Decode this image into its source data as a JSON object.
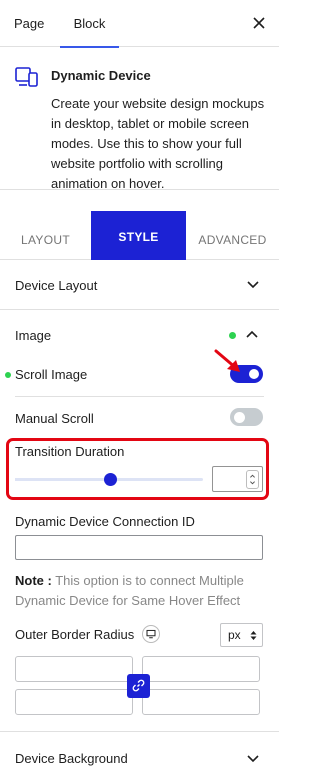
{
  "header": {
    "tabs": [
      {
        "label": "Page"
      },
      {
        "label": "Block"
      }
    ],
    "active_tab": "Block"
  },
  "block": {
    "icon": "device-icon",
    "title": "Dynamic Device",
    "description": "Create your website design mockups in desktop, tablet or mobile screen modes. Use this to show your full website portfolio with scrolling animation on hover."
  },
  "style_tabs": {
    "items": [
      {
        "label": "LAYOUT"
      },
      {
        "label": "STYLE"
      },
      {
        "label": "ADVANCED"
      }
    ],
    "active": "STYLE"
  },
  "sections": {
    "device_layout": {
      "label": "Device Layout"
    },
    "image": {
      "label": "Image"
    },
    "device_background": {
      "label": "Device Background"
    }
  },
  "image_settings": {
    "scroll_image": {
      "label": "Scroll Image",
      "enabled": true
    },
    "manual_scroll": {
      "label": "Manual Scroll",
      "enabled": false
    },
    "transition_duration": {
      "label": "Transition Duration",
      "value": "",
      "slider_fraction": 0.51
    },
    "connection_id": {
      "label": "Dynamic Device Connection ID",
      "value": ""
    },
    "note": {
      "prefix": "Note :",
      "text": "This option is to connect Multiple Dynamic Device for Same Hover Effect"
    },
    "outer_border_radius": {
      "label": "Outer Border Radius",
      "unit": "px"
    }
  },
  "colors": {
    "accent": "#1c22d4",
    "status_green": "#2dd250",
    "highlight_red": "#e30613"
  }
}
